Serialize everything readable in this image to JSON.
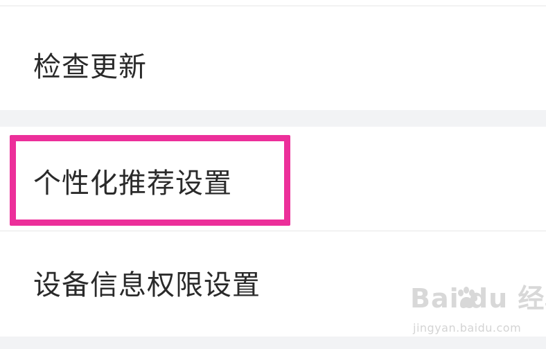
{
  "settings": {
    "items": [
      {
        "label": "检查更新"
      },
      {
        "label": "个性化推荐设置"
      },
      {
        "label": "设备信息权限设置"
      }
    ]
  },
  "highlight": {
    "target": "个性化推荐设置",
    "color": "#ec2f9a"
  },
  "watermark": {
    "text": "Bai  du 经验",
    "url": "jingyan.baidu.com"
  }
}
